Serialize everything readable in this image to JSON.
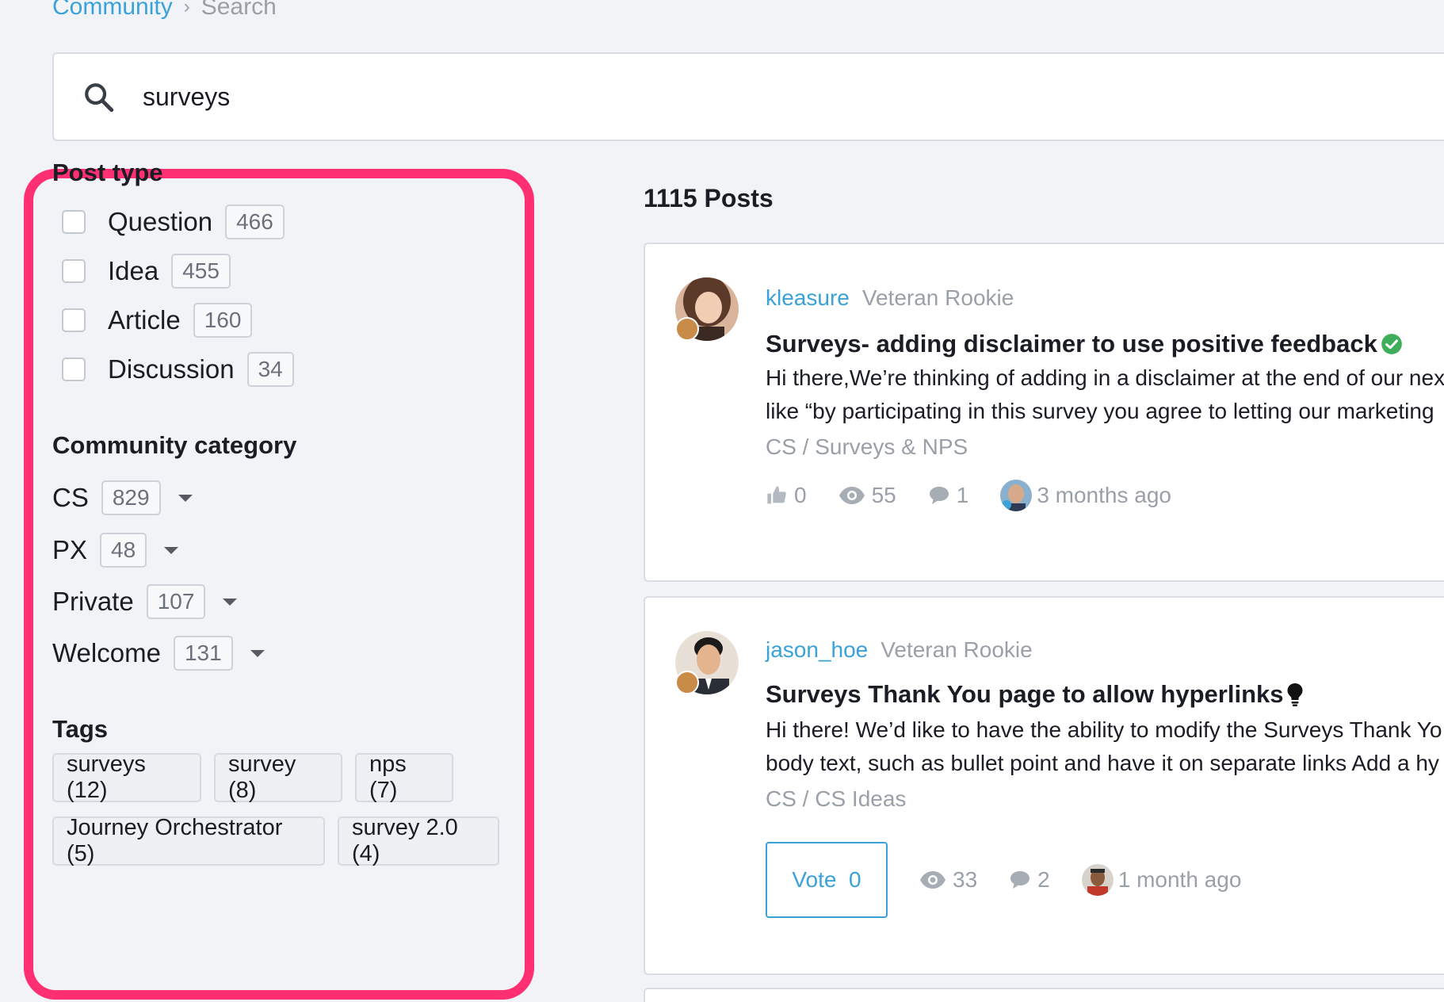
{
  "breadcrumb": {
    "root": "Community",
    "current": "Search"
  },
  "search": {
    "value": "surveys",
    "placeholder": ""
  },
  "filters": {
    "post_type": {
      "title": "Post type",
      "items": [
        {
          "label": "Question",
          "count": "466"
        },
        {
          "label": "Idea",
          "count": "455"
        },
        {
          "label": "Article",
          "count": "160"
        },
        {
          "label": "Discussion",
          "count": "34"
        }
      ]
    },
    "category": {
      "title": "Community category",
      "items": [
        {
          "label": "CS",
          "count": "829"
        },
        {
          "label": "PX",
          "count": "48"
        },
        {
          "label": "Private",
          "count": "107"
        },
        {
          "label": "Welcome",
          "count": "131"
        }
      ]
    },
    "tags": {
      "title": "Tags",
      "items": [
        "surveys (12)",
        "survey (8)",
        "nps (7)",
        "Journey Orchestrator (5)",
        "survey 2.0 (4)"
      ]
    }
  },
  "results": {
    "count_label": "1115 Posts",
    "posts": [
      {
        "author": "kleasure",
        "rank": "Veteran Rookie",
        "title": "Surveys- adding disclaimer to use positive feedback",
        "status_icon": "check-circle-icon",
        "excerpt_1": "Hi there,We’re thinking of adding in a disclaimer at the end of our nex",
        "excerpt_2": "like “by participating in this survey you agree to letting our marketing",
        "category": "CS / Surveys & NPS",
        "likes": "0",
        "views": "55",
        "comments": "1",
        "time": "3 months ago"
      },
      {
        "author": "jason_hoe",
        "rank": "Veteran Rookie",
        "title": "Surveys Thank You page to allow hyperlinks",
        "status_icon": "lightbulb-icon",
        "excerpt_1": "Hi there! We’d like to have the ability to modify the Surveys Thank Yo",
        "excerpt_2": "body text, such as bullet point and have it on separate links Add a hy",
        "category": "CS / CS Ideas",
        "vote_label": "Vote",
        "votes": "0",
        "views": "33",
        "comments": "2",
        "time": "1 month ago"
      }
    ]
  },
  "colors": {
    "accent": "#3ba2d8",
    "highlight": "#ff2f72",
    "resolved": "#3fae5a"
  }
}
